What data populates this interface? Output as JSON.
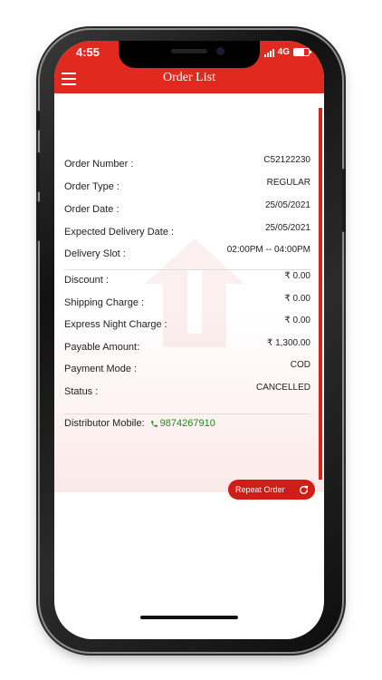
{
  "status_bar": {
    "time": "4:55",
    "network": "4G"
  },
  "header": {
    "title": "Order List"
  },
  "order": [
    {
      "label": "Order Number :",
      "value": "C52122230"
    },
    {
      "label": "Order Type :",
      "value": "REGULAR"
    },
    {
      "label": "Order Date :",
      "value": "25/05/2021"
    },
    {
      "label": "Expected Delivery Date :",
      "value": "25/05/2021"
    },
    {
      "label": "Delivery Slot :",
      "value": "02:00PM -- 04:00PM"
    }
  ],
  "charges": [
    {
      "label": "Discount :",
      "value": "₹ 0.00"
    },
    {
      "label": "Shipping Charge :",
      "value": "₹ 0.00"
    },
    {
      "label": "Express Night Charge :",
      "value": "₹ 0.00"
    },
    {
      "label": "Payable Amount:",
      "value": "₹ 1,300.00"
    },
    {
      "label": "Payment Mode :",
      "value": "COD"
    },
    {
      "label": "Status :",
      "value": "CANCELLED"
    }
  ],
  "distributor": {
    "label": "Distributor Mobile:",
    "phone": "9874267910"
  },
  "actions": {
    "repeat_label": "Repeat Order"
  },
  "colors": {
    "brand": "#e02a1f",
    "phone_link": "#1d8a1d"
  }
}
